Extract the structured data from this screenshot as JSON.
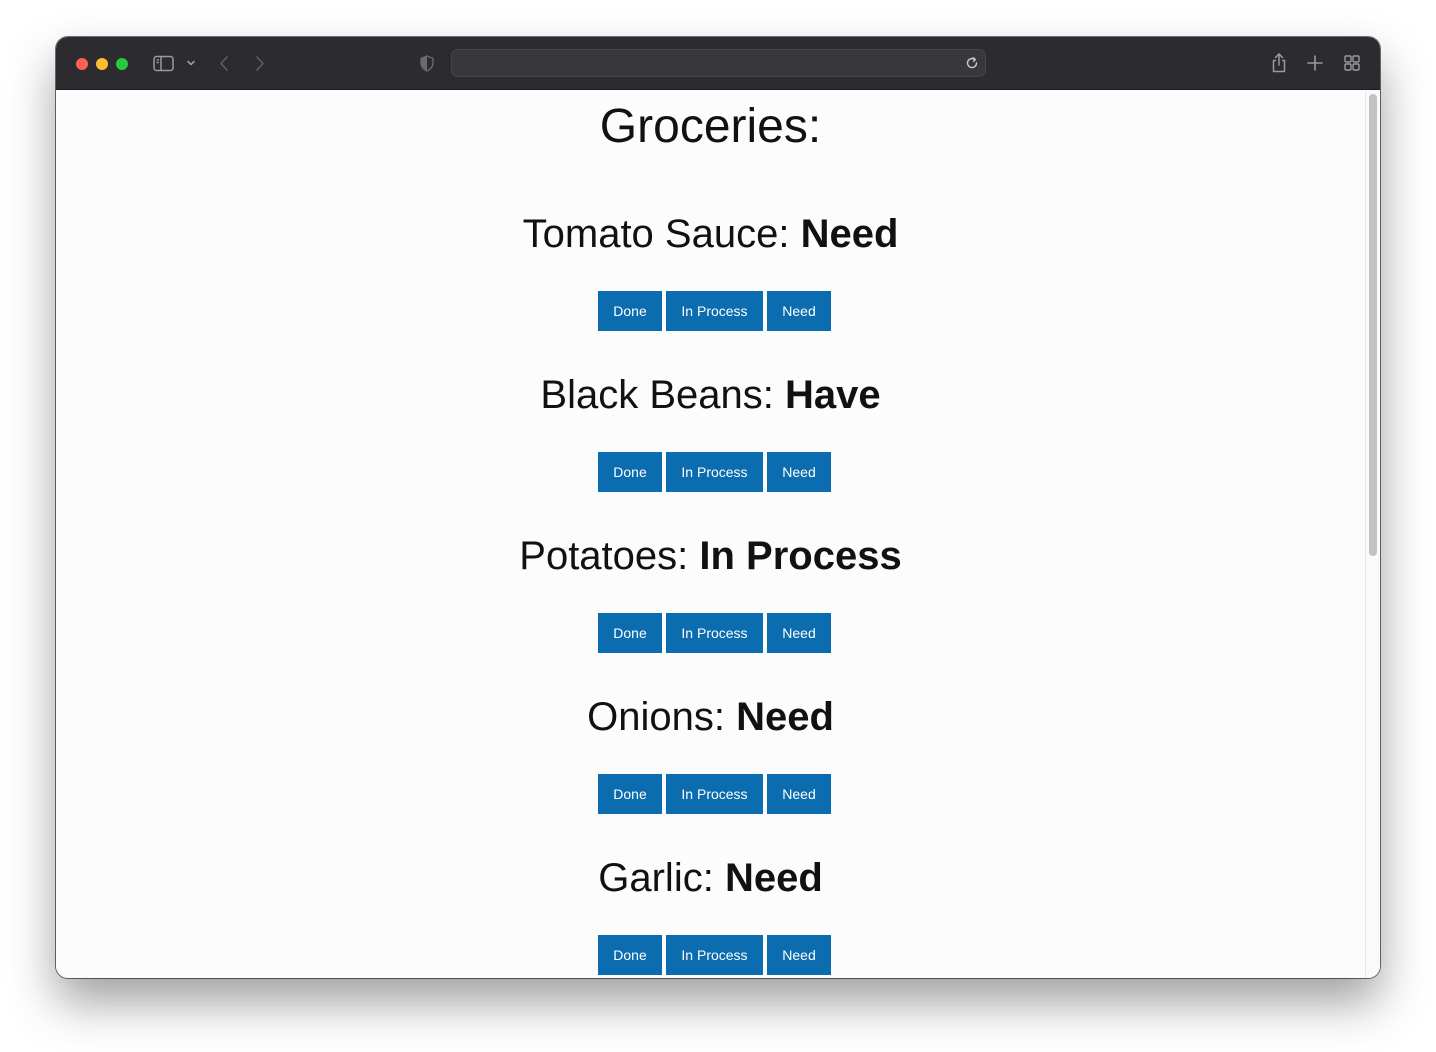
{
  "page": {
    "title": "Groceries:"
  },
  "items": [
    {
      "name": "Tomato Sauce: ",
      "status": "Need"
    },
    {
      "name": "Black Beans: ",
      "status": "Have"
    },
    {
      "name": "Potatoes: ",
      "status": "In Process"
    },
    {
      "name": "Onions: ",
      "status": "Need"
    },
    {
      "name": "Garlic: ",
      "status": "Need"
    }
  ],
  "buttons": {
    "done_label": "Done",
    "in_process_label": "In Process",
    "need_label": "Need"
  },
  "colors": {
    "button_bg": "#0b6cb0",
    "toolbar_bg": "#2c2b2f"
  }
}
